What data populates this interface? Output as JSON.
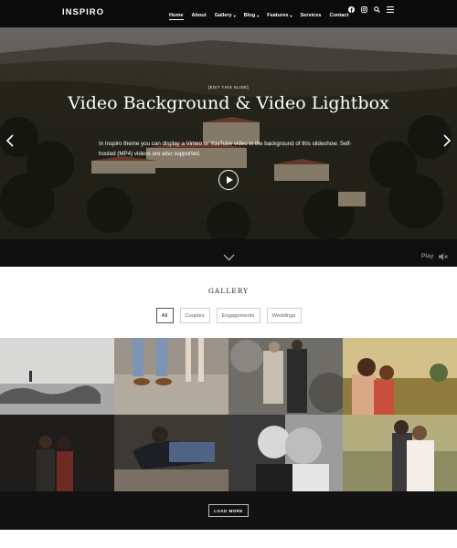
{
  "header": {
    "logo": "INSPIRO",
    "nav": [
      {
        "label": "Home",
        "active": true,
        "caret": false
      },
      {
        "label": "About",
        "active": false,
        "caret": false
      },
      {
        "label": "Gallery",
        "active": false,
        "caret": true
      },
      {
        "label": "Blog",
        "active": false,
        "caret": true
      },
      {
        "label": "Features",
        "active": false,
        "caret": true
      },
      {
        "label": "Services",
        "active": false,
        "caret": false
      },
      {
        "label": "Contact",
        "active": false,
        "caret": false
      }
    ],
    "icons": [
      "facebook-icon",
      "instagram-icon",
      "search-icon",
      "menu-icon"
    ]
  },
  "hero": {
    "edit_link": "[EDIT THIS SLIDE]",
    "title": "Video Background & Video Lightbox",
    "description": "In Inspiro theme you can display a Vimeo or YouTube video in the background of this slideshow. Self-hosted (MP4) videos are also supported.",
    "play_label": "Play"
  },
  "gallery": {
    "title": "GALLERY",
    "filters": [
      {
        "label": "All",
        "active": true
      },
      {
        "label": "Couples",
        "active": false
      },
      {
        "label": "Engagements",
        "active": false
      },
      {
        "label": "Weddings",
        "active": false
      }
    ],
    "load_more": "LOAD MORE"
  },
  "colors": {
    "header_bg": "#0b0b0b",
    "footer_bg": "#121212",
    "accent": "#ffffff"
  }
}
